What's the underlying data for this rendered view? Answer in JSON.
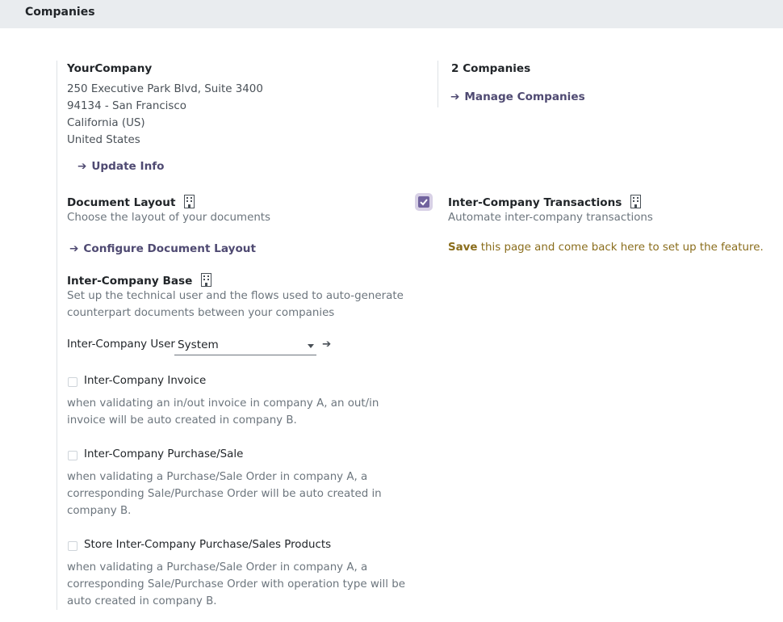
{
  "header": {
    "title": "Companies"
  },
  "company": {
    "name": "YourCompany",
    "address_lines": [
      "250 Executive Park Blvd, Suite 3400",
      "94134 - San Francisco",
      "California (US)",
      "United States"
    ],
    "update_link": "Update Info"
  },
  "companies": {
    "count_label": "2 Companies",
    "manage_link": "Manage Companies"
  },
  "document_layout": {
    "title": "Document Layout",
    "description": "Choose the layout of your documents",
    "link": "Configure Document Layout"
  },
  "inter_company_transactions": {
    "title": "Inter-Company Transactions",
    "description": "Automate inter-company transactions",
    "checked": true,
    "save_word": "Save",
    "save_rest": " this page and come back here to set up the feature."
  },
  "inter_company_base": {
    "title": "Inter-Company Base",
    "description_lines": [
      "Set up the technical user and the flows used to auto-generate",
      "counterpart documents between your companies"
    ],
    "user_label": "Inter-Company User",
    "user_value": "System",
    "options": [
      {
        "label": "Inter-Company Invoice",
        "checked": false,
        "description_lines": [
          "when validating an in/out invoice in company A, an out/in",
          "invoice will be auto created in company B."
        ]
      },
      {
        "label": "Inter-Company Purchase/Sale",
        "checked": false,
        "description_lines": [
          "when validating a Purchase/Sale Order in company A, a",
          "corresponding Sale/Purchase Order will be auto created in",
          "company B."
        ]
      },
      {
        "label": "Store Inter-Company Purchase/Sales Products",
        "checked": false,
        "description_lines": [
          "when validating a Purchase/Sale Order in company A, a",
          "corresponding Sale/Purchase Order with operation type will be",
          "auto created in company B."
        ]
      }
    ]
  },
  "colors": {
    "accent": "#71639e",
    "link": "#4f4a72",
    "warning_text": "#8a6d1c"
  }
}
